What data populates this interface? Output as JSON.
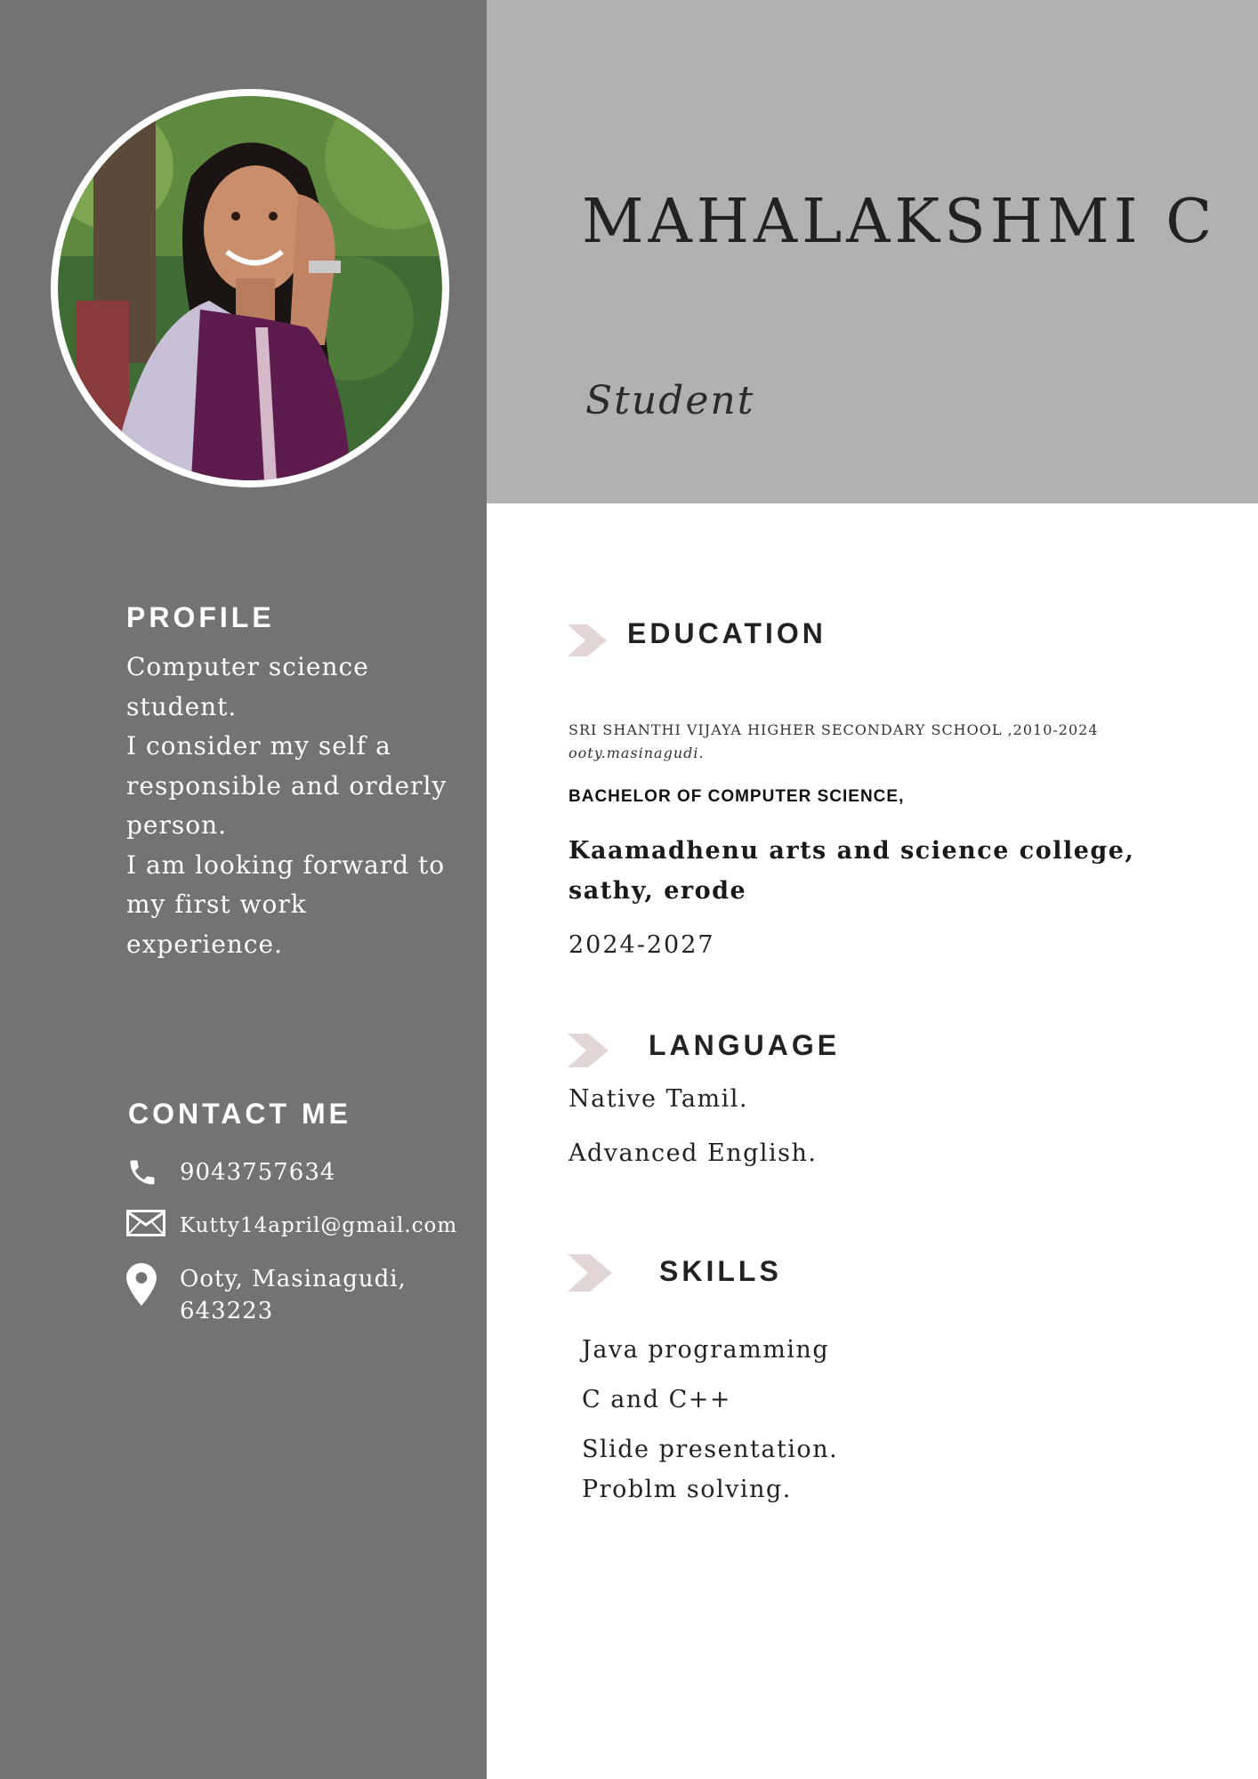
{
  "colors": {
    "sidebar": "#737373",
    "header_band": "#b1b1b1",
    "arrow": "#e2d5d6"
  },
  "header": {
    "name": "MAHALAKSHMI C",
    "role": "Student"
  },
  "profile": {
    "heading": "PROFILE",
    "lines": [
      "Computer science",
      "student.",
      "I consider my self a",
      "responsible and orderly",
      "person.",
      "I am looking forward to",
      "my first work",
      "experience."
    ]
  },
  "contact": {
    "heading": "CONTACT ME",
    "phone": "9043757634",
    "email": "Kutty14april@gmail.com",
    "address_line1": "Ooty, Masinagudi,",
    "address_line2": "643223"
  },
  "education": {
    "heading": "EDUCATION",
    "school": "SRI SHANTHI VIJAYA HIGHER SECONDARY SCHOOL ,2010-2024",
    "school_place": "ooty.masinagudi.",
    "degree": "BACHELOR OF COMPUTER SCIENCE,",
    "college": "Kaamadhenu arts and science college, sathy, erode",
    "years": "2024-2027"
  },
  "language": {
    "heading": "LANGUAGE",
    "items": [
      "Native Tamil.",
      "Advanced English."
    ]
  },
  "skills": {
    "heading": "SKILLS",
    "items": [
      "Java programming",
      "C and C++",
      "Slide presentation.",
      "Problm solving."
    ]
  }
}
